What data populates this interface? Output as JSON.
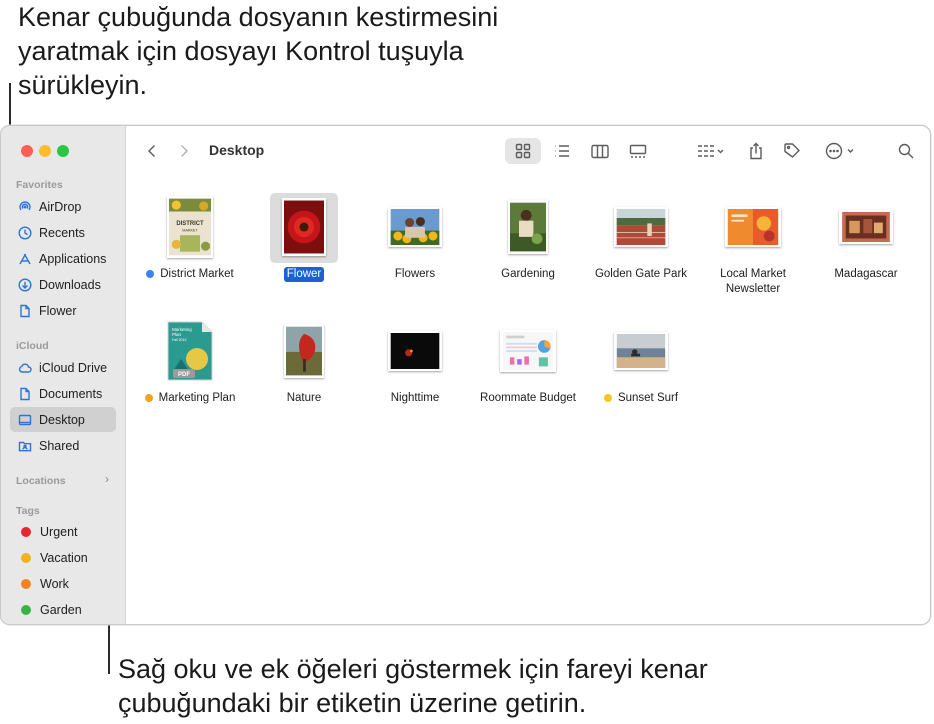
{
  "callouts": {
    "top": "Kenar çubuğunda dosyanın kestirmesini yaratmak için dosyayı Kontrol tuşuyla sürükleyin.",
    "bottom": "Sağ oku ve ek öğeleri göstermek için fareyi kenar çubuğundaki bir etiketin üzerine getirin."
  },
  "window": {
    "title": "Desktop"
  },
  "sidebar": {
    "favorites_heading": "Favorites",
    "favorites": [
      {
        "label": "AirDrop",
        "icon": "airdrop-icon"
      },
      {
        "label": "Recents",
        "icon": "clock-icon"
      },
      {
        "label": "Applications",
        "icon": "applications-icon"
      },
      {
        "label": "Downloads",
        "icon": "download-icon"
      },
      {
        "label": "Flower",
        "icon": "document-icon"
      }
    ],
    "icloud_heading": "iCloud",
    "icloud": [
      {
        "label": "iCloud Drive",
        "icon": "cloud-icon"
      },
      {
        "label": "Documents",
        "icon": "document-icon"
      },
      {
        "label": "Desktop",
        "icon": "desktop-icon",
        "selected": true
      },
      {
        "label": "Shared",
        "icon": "shared-folder-icon"
      }
    ],
    "locations_heading": "Locations",
    "tags_heading": "Tags",
    "tags": [
      {
        "label": "Urgent",
        "color": "#e6262c"
      },
      {
        "label": "Vacation",
        "color": "#f1b21b"
      },
      {
        "label": "Work",
        "color": "#f4821f"
      },
      {
        "label": "Garden",
        "color": "#37b34a"
      }
    ]
  },
  "files": [
    {
      "name": "District Market",
      "tag_color": "#3b82f6"
    },
    {
      "name": "Flower",
      "selected": true
    },
    {
      "name": "Flowers"
    },
    {
      "name": "Gardening"
    },
    {
      "name": "Golden Gate Park"
    },
    {
      "name": "Local Market Newsletter"
    },
    {
      "name": "Madagascar"
    },
    {
      "name": "Marketing Plan",
      "tag_color": "#f4a31f"
    },
    {
      "name": "Nature"
    },
    {
      "name": "Nighttime"
    },
    {
      "name": "Roommate Budget"
    },
    {
      "name": "Sunset Surf",
      "tag_color": "#f3c623"
    }
  ],
  "thumb_text": {
    "district_line1": "DISTRICT",
    "district_line2": "MARKET",
    "marketing_line1": "Marketing",
    "marketing_line2": "Plan",
    "marketing_line3": "Fall 2019",
    "marketing_ext": "PDF"
  }
}
